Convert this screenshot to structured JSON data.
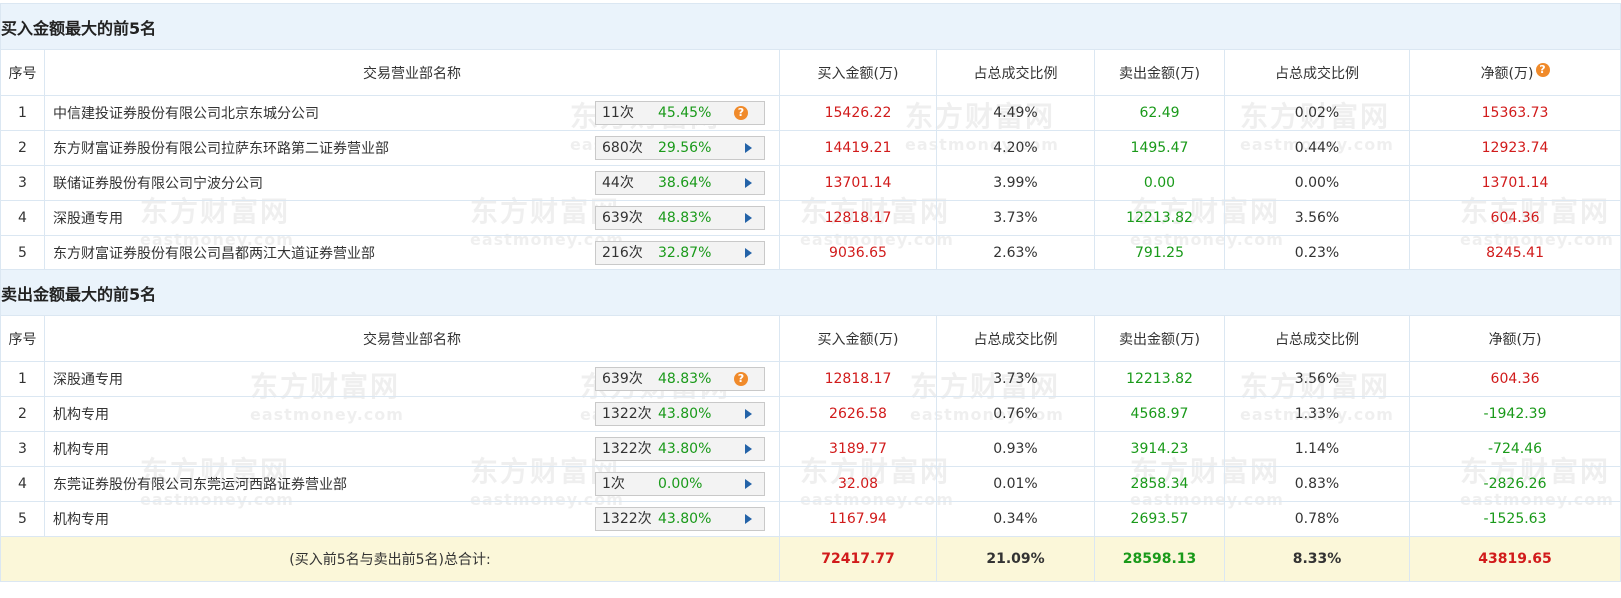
{
  "buy_section": {
    "title": "买入金额最大的前5名",
    "headers": [
      "序号",
      "交易营业部名称",
      "买入金额(万)",
      "占总成交比例",
      "卖出金额(万)",
      "占总成交比例",
      "净额(万)"
    ],
    "rows": [
      {
        "seq": "1",
        "name": "中信建投证券股份有限公司北京东城分公司",
        "count": "11次",
        "pct": "45.45%",
        "icon": "question",
        "buy": "15426.22",
        "buy_ratio": "4.49%",
        "sell": "62.49",
        "sell_ratio": "0.02%",
        "net": "15363.73"
      },
      {
        "seq": "2",
        "name": "东方财富证券股份有限公司拉萨东环路第二证券营业部",
        "count": "680次",
        "pct": "29.56%",
        "icon": "arrow",
        "buy": "14419.21",
        "buy_ratio": "4.20%",
        "sell": "1495.47",
        "sell_ratio": "0.44%",
        "net": "12923.74"
      },
      {
        "seq": "3",
        "name": "联储证券股份有限公司宁波分公司",
        "count": "44次",
        "pct": "38.64%",
        "icon": "arrow",
        "buy": "13701.14",
        "buy_ratio": "3.99%",
        "sell": "0.00",
        "sell_ratio": "0.00%",
        "net": "13701.14"
      },
      {
        "seq": "4",
        "name": "深股通专用",
        "count": "639次",
        "pct": "48.83%",
        "icon": "arrow",
        "buy": "12818.17",
        "buy_ratio": "3.73%",
        "sell": "12213.82",
        "sell_ratio": "3.56%",
        "net": "604.36"
      },
      {
        "seq": "5",
        "name": "东方财富证券股份有限公司昌都两江大道证券营业部",
        "count": "216次",
        "pct": "32.87%",
        "icon": "arrow",
        "buy": "9036.65",
        "buy_ratio": "2.63%",
        "sell": "791.25",
        "sell_ratio": "0.23%",
        "net": "8245.41"
      }
    ]
  },
  "sell_section": {
    "title": "卖出金额最大的前5名",
    "headers": [
      "序号",
      "交易营业部名称",
      "买入金额(万)",
      "占总成交比例",
      "卖出金额(万)",
      "占总成交比例",
      "净额(万)"
    ],
    "rows": [
      {
        "seq": "1",
        "name": "深股通专用",
        "count": "639次",
        "pct": "48.83%",
        "icon": "question",
        "buy": "12818.17",
        "buy_ratio": "3.73%",
        "sell": "12213.82",
        "sell_ratio": "3.56%",
        "net": "604.36"
      },
      {
        "seq": "2",
        "name": "机构专用",
        "count": "1322次",
        "pct": "43.80%",
        "icon": "arrow",
        "buy": "2626.58",
        "buy_ratio": "0.76%",
        "sell": "4568.97",
        "sell_ratio": "1.33%",
        "net": "-1942.39"
      },
      {
        "seq": "3",
        "name": "机构专用",
        "count": "1322次",
        "pct": "43.80%",
        "icon": "arrow",
        "buy": "3189.77",
        "buy_ratio": "0.93%",
        "sell": "3914.23",
        "sell_ratio": "1.14%",
        "net": "-724.46"
      },
      {
        "seq": "4",
        "name": "东莞证券股份有限公司东莞运河西路证券营业部",
        "count": "1次",
        "pct": "0.00%",
        "icon": "arrow",
        "buy": "32.08",
        "buy_ratio": "0.01%",
        "sell": "2858.34",
        "sell_ratio": "0.83%",
        "net": "-2826.26"
      },
      {
        "seq": "5",
        "name": "机构专用",
        "count": "1322次",
        "pct": "43.80%",
        "icon": "arrow",
        "buy": "1167.94",
        "buy_ratio": "0.34%",
        "sell": "2693.57",
        "sell_ratio": "0.78%",
        "net": "-1525.63"
      }
    ]
  },
  "total": {
    "label": "(买入前5名与卖出前5名)总合计:",
    "buy": "72417.77",
    "buy_ratio": "21.09%",
    "sell": "28598.13",
    "sell_ratio": "8.33%",
    "net": "43819.65"
  },
  "watermark": {
    "cn": "东方财富网",
    "en": "eastmoney.com"
  },
  "colors": {
    "red": "#d11b1b",
    "green": "#1a9a1a",
    "header_bg": "#eaf3fb",
    "total_bg": "#fbf7d9",
    "accent_orange": "#f08a2a",
    "arrow_blue": "#2463a8"
  }
}
